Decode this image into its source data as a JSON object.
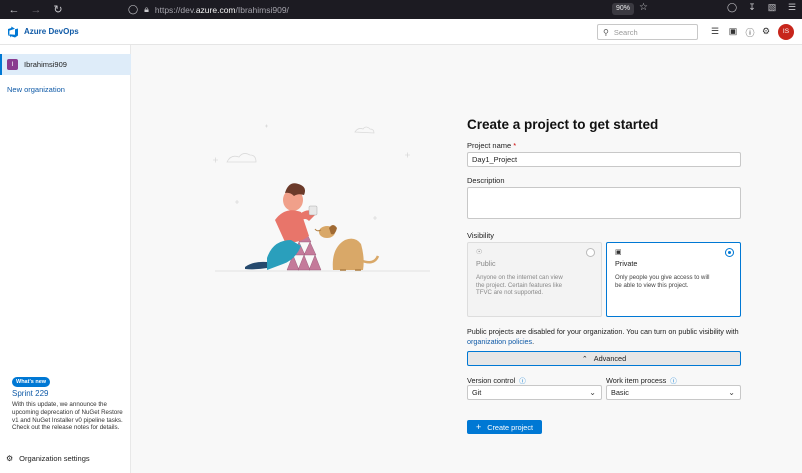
{
  "browser": {
    "url_prefix": "https://dev.",
    "url_domain": "azure.com",
    "url_path": "/Ibrahimsi909/",
    "zoom": "90%"
  },
  "header": {
    "brand": "Azure DevOps",
    "search_placeholder": "Search",
    "avatar_initials": "IS",
    "colors": {
      "brand_blue": "#0078d4",
      "avatar_red": "#c7261c"
    }
  },
  "sidebar": {
    "org_initial": "I",
    "org_name": "Ibrahimsi909",
    "new_org": "New organization",
    "whats_new_badge": "What's new",
    "sprint_title": "Sprint 229",
    "sprint_text": "With this update, we announce the upcoming deprecation of NuGet Restore v1 and NuGet Installer v0 pipeline tasks. Check out the release notes for details.",
    "org_settings": "Organization settings"
  },
  "form": {
    "title": "Create a project to get started",
    "project_name_label": "Project name",
    "project_name_required": "*",
    "project_name_value": "Day1_Project",
    "description_label": "Description",
    "visibility_label": "Visibility",
    "public": {
      "name": "Public",
      "desc": "Anyone on the internet can view the project. Certain features like TFVC are not supported."
    },
    "private": {
      "name": "Private",
      "desc": "Only people you give access to will be able to view this project."
    },
    "notice_text": "Public projects are disabled for your organization. You can turn on public visibility with",
    "notice_link": "organization policies",
    "notice_end": ".",
    "advanced_label": "Advanced",
    "version_control_label": "Version control",
    "version_control_value": "Git",
    "work_item_label": "Work item process",
    "work_item_value": "Basic",
    "create_button": "Create project"
  }
}
